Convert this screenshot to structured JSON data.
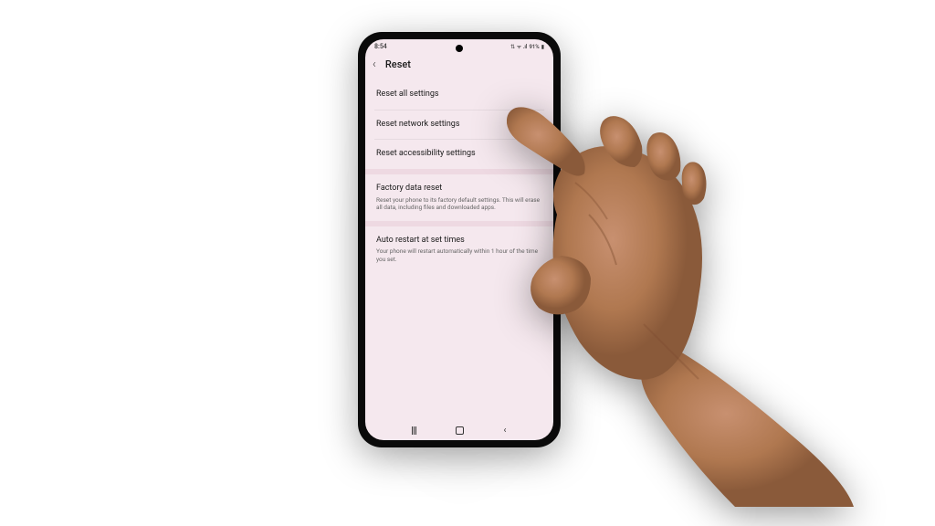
{
  "status_bar": {
    "time": "8:54",
    "battery": "91%",
    "signal_icons": "⇅ ᯤ .ıl"
  },
  "header": {
    "title": "Reset"
  },
  "settings": {
    "items": [
      {
        "title": "Reset all settings",
        "subtitle": ""
      },
      {
        "title": "Reset network settings",
        "subtitle": ""
      },
      {
        "title": "Reset accessibility settings",
        "subtitle": ""
      },
      {
        "title": "Factory data reset",
        "subtitle": "Reset your phone to its factory default settings. This will erase all data, including files and downloaded apps."
      },
      {
        "title": "Auto restart at set times",
        "subtitle": "Your phone will restart automatically within 1 hour of the time you set."
      }
    ]
  },
  "nav": {
    "recent": "|||",
    "home": "◯",
    "back": "‹"
  }
}
